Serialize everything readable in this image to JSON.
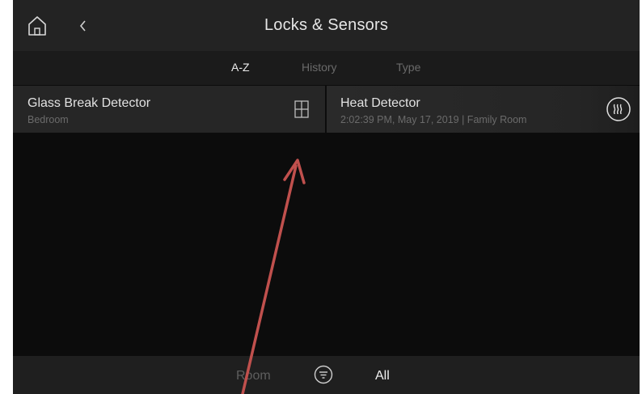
{
  "header": {
    "title": "Locks & Sensors",
    "home_icon": "home-icon",
    "back_icon": "chevron-left-icon"
  },
  "tabs": [
    {
      "label": "A-Z",
      "active": true
    },
    {
      "label": "History",
      "active": false
    },
    {
      "label": "Type",
      "active": false
    }
  ],
  "devices": [
    {
      "name": "Glass Break Detector",
      "detail": "Bedroom",
      "icon": "window-icon"
    },
    {
      "name": "Heat Detector",
      "detail": "2:02:39 PM, May 17, 2019 | Family Room",
      "icon": "heat-icon"
    }
  ],
  "footer": {
    "room_label": "Room",
    "filter_icon": "filter-icon",
    "selected": "All"
  },
  "colors": {
    "background": "#0c0c0c",
    "header": "#232323",
    "card": "#262626",
    "annotation_arrow": "#c0504d"
  }
}
